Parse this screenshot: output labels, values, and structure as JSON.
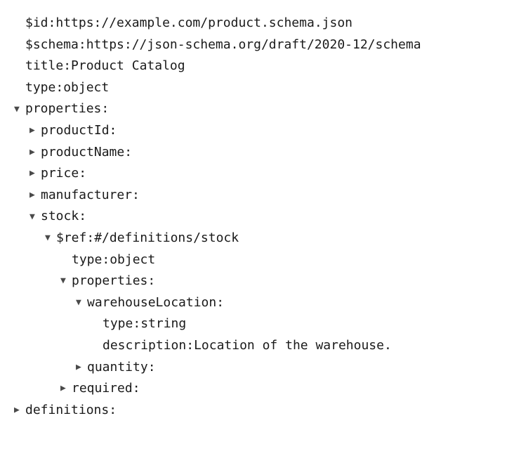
{
  "glyphs": {
    "expanded": "▼",
    "collapsed": "▶"
  },
  "lines": [
    {
      "indent": 0,
      "toggle": null,
      "key": "$id",
      "value": "https://example.com/product.schema.json"
    },
    {
      "indent": 0,
      "toggle": null,
      "key": "$schema",
      "value": "https://json-schema.org/draft/2020-12/schema"
    },
    {
      "indent": 0,
      "toggle": null,
      "key": "title",
      "value": "Product Catalog"
    },
    {
      "indent": 0,
      "toggle": null,
      "key": "type",
      "value": "object"
    },
    {
      "indent": 0,
      "toggle": "expanded",
      "key": "properties",
      "value": ""
    },
    {
      "indent": 1,
      "toggle": "collapsed",
      "key": "productId",
      "value": ""
    },
    {
      "indent": 1,
      "toggle": "collapsed",
      "key": "productName",
      "value": ""
    },
    {
      "indent": 1,
      "toggle": "collapsed",
      "key": "price",
      "value": ""
    },
    {
      "indent": 1,
      "toggle": "collapsed",
      "key": "manufacturer",
      "value": ""
    },
    {
      "indent": 1,
      "toggle": "expanded",
      "key": "stock",
      "value": ""
    },
    {
      "indent": 2,
      "toggle": "expanded",
      "key": "$ref",
      "value": "#/definitions/stock"
    },
    {
      "indent": 3,
      "toggle": null,
      "key": "type",
      "value": "object"
    },
    {
      "indent": 3,
      "toggle": "expanded",
      "key": "properties",
      "value": ""
    },
    {
      "indent": 4,
      "toggle": "expanded",
      "key": "warehouseLocation",
      "value": ""
    },
    {
      "indent": 5,
      "toggle": null,
      "key": "type",
      "value": "string"
    },
    {
      "indent": 5,
      "toggle": null,
      "key": "description",
      "value": "Location of the warehouse."
    },
    {
      "indent": 4,
      "toggle": "collapsed",
      "key": "quantity",
      "value": ""
    },
    {
      "indent": 3,
      "toggle": "collapsed",
      "key": "required",
      "value": ""
    },
    {
      "indent": 0,
      "toggle": "collapsed",
      "key": "definitions",
      "value": ""
    }
  ]
}
